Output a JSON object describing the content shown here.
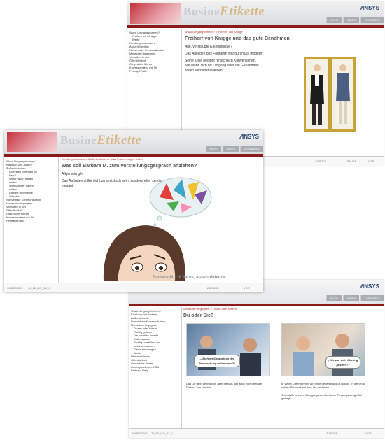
{
  "brand": "INSYS",
  "logo": {
    "prefix": "Busine",
    "script": "Etikette"
  },
  "nav": [
    "HILFE",
    "INDEX",
    "LERNZIELE"
  ],
  "win1": {
    "sidebar": [
      "Wozu Umgangsformen?",
      "Freiherr von Knigge",
      "Werte",
      "Kleidung und andere",
      "Äußerlichkeiten",
      "Nonverbale Kommunikation",
      "Menschen begegnen",
      "Verhalten in der",
      "Öffentlichkeit",
      "Gespräche führen",
      "Korrespondenz mit Stil",
      "Fettnapf-Rally"
    ],
    "breadcrumb": "Wozu Umgangsformen? > Freiherr von Knigge",
    "title": "Freiherr von Knigge und das gute Benehmen",
    "p1": "Alte, verstaubte Erkenntnisse?",
    "p2": "Das Anliegen des Freiherrn war durchaus modern:",
    "p3": "Seine Ziele beginnt hinsichtlich Konventionen, wie Mann sich für Umgang über die Gesamtheit sollen Verhaltensweisen",
    "footer": [
      "ZURÜCK",
      "PAUSE",
      "VOR"
    ]
  },
  "win2": {
    "sidebar": [
      "Wozu Umgangsformen?",
      "Kleidung und andere",
      "Äußerlichkeiten",
      "Korrektes Auftreten im",
      "Beruf",
      "Was Frauen tragen",
      "sollten",
      "Was Männer tragen",
      "sollten",
      "Kleine Farbenlehre",
      "Wäsche",
      "Nonverbale Kommunikation",
      "Menschen begegnen",
      "Verhalten in der",
      "Öffentlichkeit",
      "Gespräche führen",
      "Korrespondenz mit Stil",
      "Fettnapf-Rally"
    ],
    "breadcrumb": "Kleidung und andere Äußerlichkeiten > Was Frauen tragen sollten",
    "title": "Was soll Barbara M. zum Vorstellungsgespräch anziehen?",
    "p1": "Allgemein gilt:",
    "p2": "Das Auftreten sollte nicht zu sexistisch sein, sondern eher seriös-elegant.",
    "caption": "Barbara M., 18 Jahre, Auszubildende",
    "footer": [
      "SHBBOOKS",
      "16_10_BG_EM_1",
      "ZURÜCK",
      "VOR"
    ]
  },
  "win3": {
    "sidebar": [
      "Wozu Umgangsformen?",
      "Kleidung und andere",
      "Äußerlichkeiten",
      "Nonverbale Kommunikation",
      "Menschen begegnen",
      "Duzen oder Siezen",
      "Richtig grüßen",
      "Die korrekte Anrede",
      "Visitenkarten",
      "Richtig vorstellen und",
      "bekannt machen",
      "Gäste empfangen",
      "Weiter",
      "Verhalten in der",
      "Öffentlichkeit",
      "Gespräche führen",
      "Korrespondenz mit Stil",
      "Fettnapf-Rally"
    ],
    "breadcrumb": "Menschen begegnen > Duzen oder Siezen",
    "title": "Du oder Sie?",
    "bubble1": "„Möchten Sie auch an der Besprechung teilnehmen?“",
    "bubble2": "„Wie war dein Meeting gestern?“",
    "left_text": "Das Du wirkt vertraulich, aber oftmals hält auch eine gewisse Distanz ihre Vorteile.",
    "right_text1": "In vielen Unternehmen ist heute generell das Du üblich. In dem Fall sollten Sie nicht auf dem Sie bestehen.",
    "right_text2": "Jedenfalls ist beim Übergang zum Du immer Fingerspitzengefühl gefragt!",
    "footer": [
      "SHBBOOKS",
      "16_12_GO_ST_1",
      "ZURÜCK",
      "VOR"
    ]
  }
}
